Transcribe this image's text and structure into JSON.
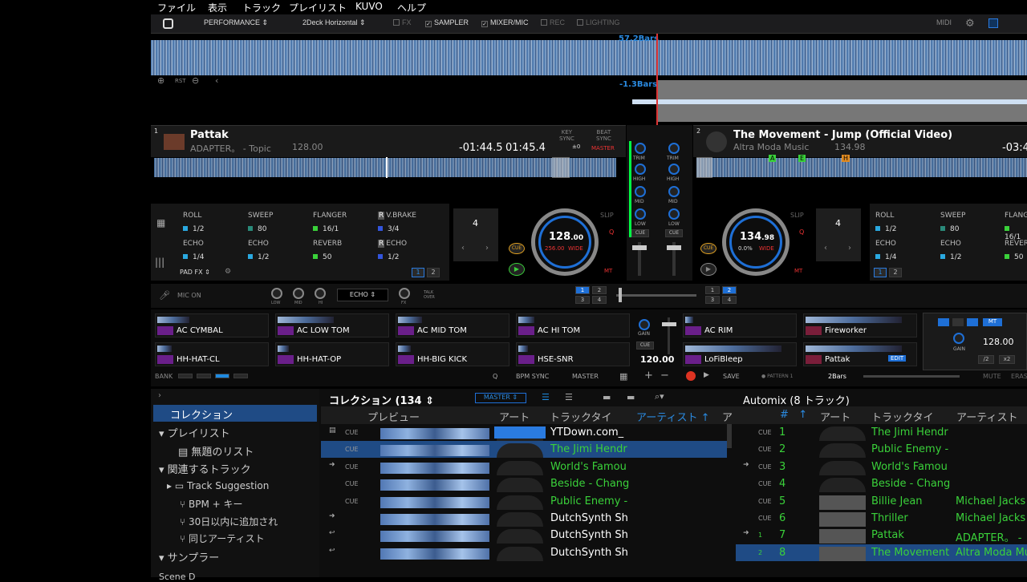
{
  "menu": [
    "ファイル",
    "表示",
    "トラック",
    "プレイリスト",
    "KUVO",
    "ヘルプ"
  ],
  "toolbar": {
    "mode": "PERFORMANCE",
    "layout": "2Deck Horizontal",
    "fx": "FX",
    "sampler": "SAMPLER",
    "mixer": "MIXER/MIC",
    "rec": "REC",
    "lighting": "LIGHTING",
    "midi": "MIDI"
  },
  "overview": {
    "bars_top": "57.2Bars",
    "bars_bottom": "-1.3Bars",
    "rst": "RST"
  },
  "deck1": {
    "num": "1",
    "title": "Pattak",
    "artist": "ADAPTER。 - Topic",
    "bpm_small": "128.00",
    "remain": "-01:44.5",
    "elapsed": "01:45.4",
    "key_sync": "KEY\nSYNC",
    "beat_sync": "BEAT\nSYNC",
    "master": "MASTER",
    "zero": "±0",
    "bpm": "128",
    "bpm_dec": ".00",
    "sub_bpm": "256.00",
    "range": "WIDE",
    "slip": "SLIP",
    "q": "Q",
    "mt": "MT",
    "cue": "CUE",
    "loop": "4",
    "fx": [
      {
        "name": "ROLL",
        "val": "1/2",
        "color": "#2aa9e0"
      },
      {
        "name": "SWEEP",
        "val": "80",
        "color": "#2a8a7a"
      },
      {
        "name": "FLANGER",
        "val": "16/1",
        "color": "#3ad13a"
      },
      {
        "name": "V.BRAKE",
        "val": "3/4",
        "color": "#3355dd",
        "r": "R"
      },
      {
        "name": "ECHO",
        "val": "1/4",
        "color": "#2aa9e0"
      },
      {
        "name": "ECHO",
        "val": "1/2",
        "color": "#2aa9e0"
      },
      {
        "name": "REVERB",
        "val": "50",
        "color": "#3ad13a"
      },
      {
        "name": "ECHO",
        "val": "1/2",
        "color": "#3355dd",
        "r": "R"
      }
    ],
    "padfx": "PAD FX",
    "page1": "1",
    "page2": "2"
  },
  "deck2": {
    "num": "2",
    "title": "The Movement - Jump (Official Video)",
    "artist": "Altra Moda Music",
    "bpm_small": "134.98",
    "remain": "-03:4",
    "bpm": "134",
    "bpm_dec": ".98",
    "sub_bpm": "0.0%",
    "range": "WIDE",
    "slip": "SLIP",
    "q": "Q",
    "mt": "MT",
    "cue": "CUE",
    "loop": "4",
    "fx": [
      {
        "name": "ROLL",
        "val": "1/2",
        "color": "#2aa9e0"
      },
      {
        "name": "SWEEP",
        "val": "80",
        "color": "#2a8a7a"
      },
      {
        "name": "FLANG",
        "val": "16/1",
        "color": "#3ad13a"
      },
      {
        "name": "ECHO",
        "val": "1/4",
        "color": "#2aa9e0"
      },
      {
        "name": "ECHO",
        "val": "1/2",
        "color": "#2aa9e0"
      },
      {
        "name": "REVER",
        "val": "50",
        "color": "#3ad13a"
      }
    ],
    "page1": "1",
    "page2": "2",
    "markers": [
      "A",
      "E",
      "H"
    ]
  },
  "mixer": {
    "trim": "TRIM",
    "high": "HIGH",
    "mid": "MID",
    "low": "LOW",
    "cue": "CUE"
  },
  "mic": {
    "label": "MIC ON",
    "low": "LOW",
    "mid": "MID",
    "hi": "HI",
    "fx": "ECHO",
    "fxlbl": "FX",
    "talk": "TALK\nOVER"
  },
  "pages": [
    "1",
    "2",
    "3",
    "4"
  ],
  "sampler": {
    "slots": [
      "AC CYMBAL",
      "AC LOW TOM",
      "AC MID TOM",
      "AC HI TOM",
      "HH-HAT-CL",
      "HH-HAT-OP",
      "HH-BIG KICK",
      "HSE-SNR"
    ],
    "slots2": [
      "AC RIM",
      "Fireworker",
      "LoFiBleep",
      "Pattak"
    ],
    "gain": "GAIN",
    "cue": "CUE",
    "bpm": "120.00",
    "bank": "BANK",
    "bpm_sync": "BPM SYNC",
    "master": "MASTER",
    "save": "SAVE",
    "pattern": "PATTERN 1",
    "bars": "2Bars",
    "mute": "MUTE",
    "erase": "ERAS",
    "edit": "EDIT",
    "mt": "MT",
    "right_bpm": "128.00",
    "right_gain": "GAIN",
    "half": "/2",
    "double": "x2"
  },
  "tree": {
    "collection": "コレクション",
    "playlist": "プレイリスト",
    "untitled": "無題のリスト",
    "related": "関連するトラック",
    "suggestion": "Track Suggestion",
    "bpmkey": "BPM + キー",
    "recent": "30日以内に追加され",
    "same_artist": "同じアーティスト",
    "sampler": "サンプラー",
    "bottom": "Scene D"
  },
  "collection": {
    "title": "コレクション (134",
    "master": "MASTER",
    "cols": {
      "preview": "プレビュー",
      "art": "アート",
      "track": "トラックタイ",
      "artist": "アーティスト ↑",
      "more": "ア"
    },
    "rows": [
      {
        "cue": "CUE",
        "title": "YTDown.com_",
        "color": "#ffffff",
        "sel": false,
        "mark": "▤"
      },
      {
        "cue": "CUE",
        "title": "The Jimi Hendr",
        "color": "#3ad13a",
        "sel": true,
        "mark": ""
      },
      {
        "cue": "CUE",
        "title": "World's Famou",
        "color": "#3ad13a",
        "sel": false,
        "mark": "➜"
      },
      {
        "cue": "CUE",
        "title": "Beside - Chang",
        "color": "#3ad13a",
        "sel": false,
        "mark": ""
      },
      {
        "cue": "CUE",
        "title": "Public Enemy -",
        "color": "#3ad13a",
        "sel": false,
        "mark": ""
      },
      {
        "cue": "",
        "title": "DutchSynth Sh",
        "color": "#ffffff",
        "sel": false,
        "mark": "➜"
      },
      {
        "cue": "",
        "title": "DutchSynth Sh",
        "color": "#ffffff",
        "sel": false,
        "mark": "↩"
      },
      {
        "cue": "",
        "title": "DutchSynth Sh",
        "color": "#ffffff",
        "sel": false,
        "mark": "↩"
      }
    ]
  },
  "automix": {
    "title": "Automix (8 トラック)",
    "cols": {
      "num": "#",
      "art": "アート",
      "track": "トラックタイ",
      "artist": "アーティスト"
    },
    "rows": [
      {
        "cue": "CUE",
        "n": "1",
        "title": "The Jimi Hendr",
        "artist": "",
        "color": "#3ad13a",
        "mark": ""
      },
      {
        "cue": "CUE",
        "n": "2",
        "title": "Public Enemy -",
        "artist": "",
        "color": "#3ad13a",
        "mark": ""
      },
      {
        "cue": "CUE",
        "n": "3",
        "title": "World's Famou",
        "artist": "",
        "color": "#3ad13a",
        "mark": "➜"
      },
      {
        "cue": "CUE",
        "n": "4",
        "title": "Beside - Chang",
        "artist": "",
        "color": "#3ad13a",
        "mark": ""
      },
      {
        "cue": "CUE",
        "n": "5",
        "title": "Billie Jean",
        "artist": "Michael Jacks",
        "color": "#3ad13a",
        "mark": ""
      },
      {
        "cue": "CUE",
        "n": "6",
        "title": "Thriller",
        "artist": "Michael Jacks",
        "color": "#3ad13a",
        "mark": ""
      },
      {
        "cue": "1",
        "n": "7",
        "title": "Pattak",
        "artist": "ADAPTER。 -",
        "color": "#3ad13a",
        "mark": "➜"
      },
      {
        "cue": "2",
        "n": "8",
        "title": "The Movement",
        "artist": "Altra Moda Mu",
        "color": "#3ad13a",
        "mark": ""
      }
    ]
  }
}
